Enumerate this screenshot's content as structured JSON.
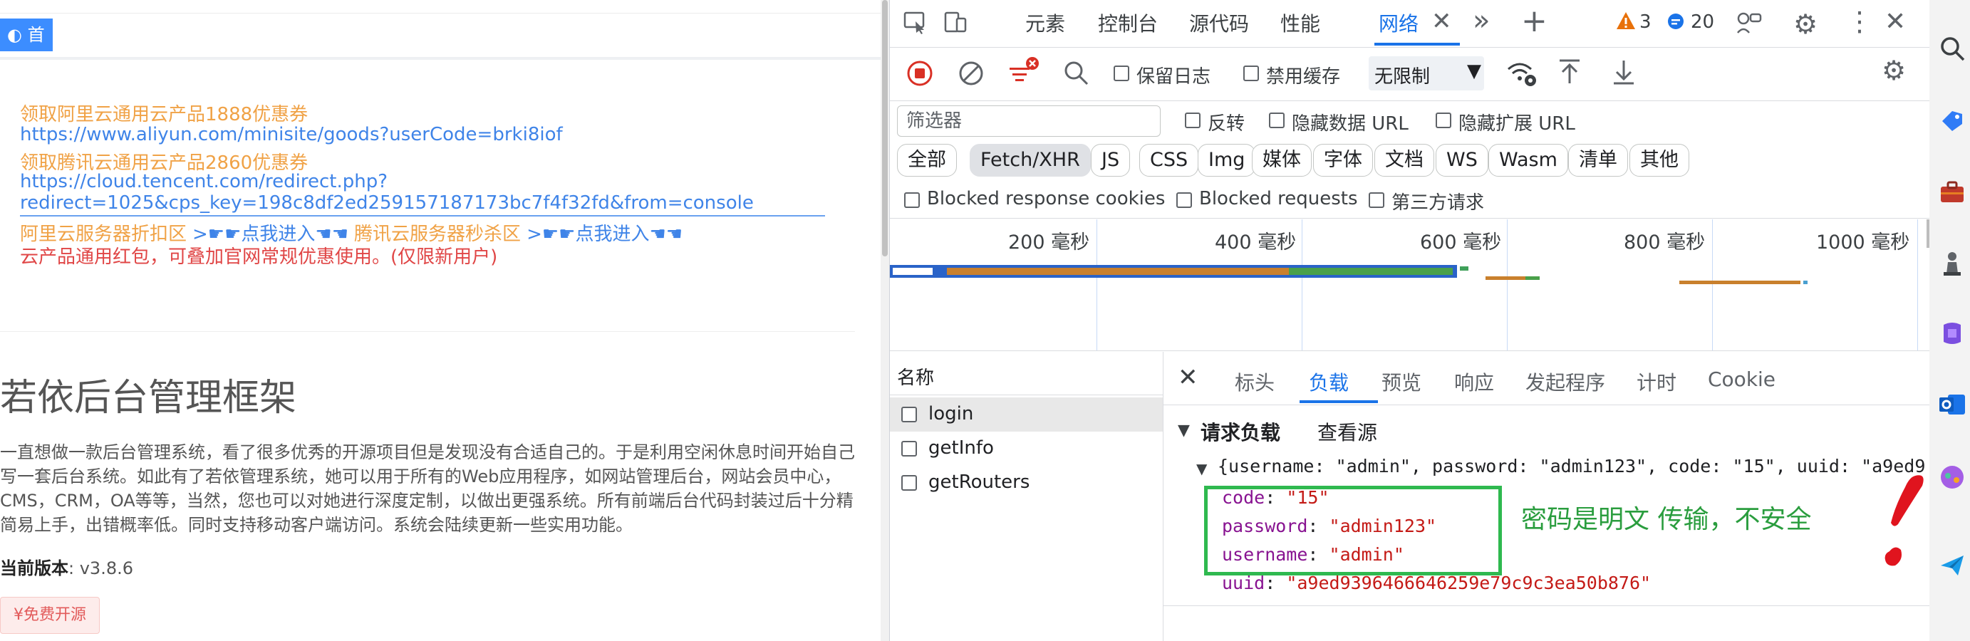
{
  "page": {
    "home_tab": "◐ 首页",
    "promo": {
      "line1": "领取阿里云通用云产品1888优惠券",
      "url1": "https://www.aliyun.com/minisite/goods?userCode=brki8iof",
      "line2": "领取腾讯云通用云产品2860优惠券",
      "url2a": "https://cloud.tencent.com/redirect.php?",
      "url2b": "redirect=1025&cps_key=198c8df2ed259157187173bc7f4f32fd&from=console",
      "row3_a": "阿里云服务器折扣区",
      "row3_enter1": ">☛☛点我进入☚☚",
      "row3_b": "腾讯云服务器秒杀区",
      "row3_enter2": ">☛☛点我进入☚☚",
      "line4": "云产品通用红包，可叠加官网常规优惠使用。(仅限新用户)"
    },
    "title": "若依后台管理框架",
    "desc": "一直想做一款后台管理系统，看了很多优秀的开源项目但是发现没有合适自己的。于是利用空闲休息时间开始自己写一套后台系统。如此有了若依管理系统，她可以用于所有的Web应用程序，如网站管理后台，网站会员中心，CMS，CRM，OA等等，当然，您也可以对她进行深度定制，以做出更强系统。所有前端后台代码封装过后十分精简易上手，出错概率低。同时支持移动客户端访问。系统会陆续更新一些实用功能。",
    "version_label": "当前版本",
    "version_value": ": v3.8.6",
    "free_badge": "¥免费开源"
  },
  "devtools": {
    "tabs": [
      "元素",
      "控制台",
      "源代码",
      "性能",
      "网络"
    ],
    "warnings_count": "3",
    "messages_count": "20",
    "toolbar2": {
      "preserve_log": "保留日志",
      "disable_cache": "禁用缓存",
      "throttle": "无限制"
    },
    "filter": {
      "placeholder": "筛选器",
      "invert": "反转",
      "hide_data_url": "隐藏数据 URL",
      "hide_ext_url": "隐藏扩展 URL"
    },
    "types": [
      "全部",
      "Fetch/XHR",
      "JS",
      "CSS",
      "Img",
      "媒体",
      "字体",
      "文档",
      "WS",
      "Wasm",
      "清单",
      "其他"
    ],
    "blocked": {
      "cookies": "Blocked response cookies",
      "requests": "Blocked requests",
      "third_party": "第三方请求"
    },
    "timeline_labels": [
      "200  毫秒",
      "400  毫秒",
      "600  毫秒",
      "800  毫秒",
      "1000  毫秒"
    ],
    "name_header": "名称",
    "requests": [
      "login",
      "getInfo",
      "getRouters"
    ],
    "detail_tabs": [
      "标头",
      "负载",
      "预览",
      "响应",
      "发起程序",
      "计时",
      "Cookie"
    ],
    "payload": {
      "section_title": "请求负载",
      "view_source": "查看源",
      "summary": "{username: \"admin\", password: \"admin123\", code: \"15\", uuid: \"a9ed9",
      "fields": [
        {
          "key": "code",
          "value": "\"15\""
        },
        {
          "key": "password",
          "value": "\"admin123\""
        },
        {
          "key": "username",
          "value": "\"admin\""
        },
        {
          "key": "uuid",
          "value": "\"a9ed9396466646259e79c9c3ea50b876\""
        }
      ]
    },
    "annotation": "密码是明文 传输，不安全"
  },
  "colors": {
    "accent": "#1a73e8",
    "home_tab": "#3c8dff",
    "promo_orange": "#f0a246",
    "promo_blue": "#3f84e8",
    "promo_red": "#e04646",
    "annotation_green": "#2fb94f",
    "annotation_red": "#e0141e"
  }
}
